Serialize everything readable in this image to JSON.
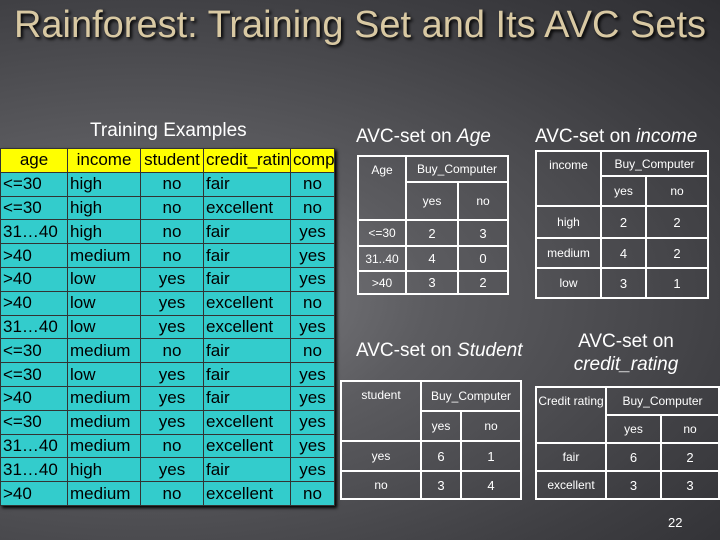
{
  "title": "Rainforest:  Training Set and Its AVC Sets",
  "training": {
    "label": "Training Examples",
    "headers": [
      "age",
      "income",
      "student",
      "credit_rating",
      "comp"
    ],
    "rows": [
      [
        "<=30",
        "high",
        "no",
        "fair",
        "no"
      ],
      [
        "<=30",
        "high",
        "no",
        "excellent",
        "no"
      ],
      [
        "31…40",
        "high",
        "no",
        "fair",
        "yes"
      ],
      [
        ">40",
        "medium",
        "no",
        "fair",
        "yes"
      ],
      [
        ">40",
        "low",
        "yes",
        "fair",
        "yes"
      ],
      [
        ">40",
        "low",
        "yes",
        "excellent",
        "no"
      ],
      [
        "31…40",
        "low",
        "yes",
        "excellent",
        "yes"
      ],
      [
        "<=30",
        "medium",
        "no",
        "fair",
        "no"
      ],
      [
        "<=30",
        "low",
        "yes",
        "fair",
        "yes"
      ],
      [
        ">40",
        "medium",
        "yes",
        "fair",
        "yes"
      ],
      [
        "<=30",
        "medium",
        "yes",
        "excellent",
        "yes"
      ],
      [
        "31…40",
        "medium",
        "no",
        "excellent",
        "yes"
      ],
      [
        "31…40",
        "high",
        "yes",
        "fair",
        "yes"
      ],
      [
        ">40",
        "medium",
        "no",
        "excellent",
        "no"
      ]
    ]
  },
  "avc_age": {
    "label_prefix": "AVC-set on ",
    "label_attr": "Age",
    "attr": "Age",
    "class": "Buy_Computer",
    "yes": "yes",
    "no": "no",
    "rows": [
      [
        "<=30",
        "2",
        "3"
      ],
      [
        "31..40",
        "4",
        "0"
      ],
      [
        ">40",
        "3",
        "2"
      ]
    ]
  },
  "avc_income": {
    "label_prefix": "AVC-set on ",
    "label_attr": "income",
    "attr": "income",
    "class": "Buy_Computer",
    "yes": "yes",
    "no": "no",
    "rows": [
      [
        "high",
        "2",
        "2"
      ],
      [
        "medium",
        "4",
        "2"
      ],
      [
        "low",
        "3",
        "1"
      ]
    ]
  },
  "avc_student": {
    "label_prefix": "AVC-set on ",
    "label_attr": "Student",
    "attr": "student",
    "class": "Buy_Computer",
    "yes": "yes",
    "no": "no",
    "rows": [
      [
        "yes",
        "6",
        "1"
      ],
      [
        "no",
        "3",
        "4"
      ]
    ]
  },
  "avc_credit": {
    "label_prefix": "AVC-set on",
    "label_attr": "credit_rating",
    "attr": "Credit rating",
    "class": "Buy_Computer",
    "yes": "yes",
    "no": "no",
    "rows": [
      [
        "fair",
        "6",
        "2"
      ],
      [
        "excellent",
        "3",
        "3"
      ]
    ]
  },
  "page_number": "22"
}
